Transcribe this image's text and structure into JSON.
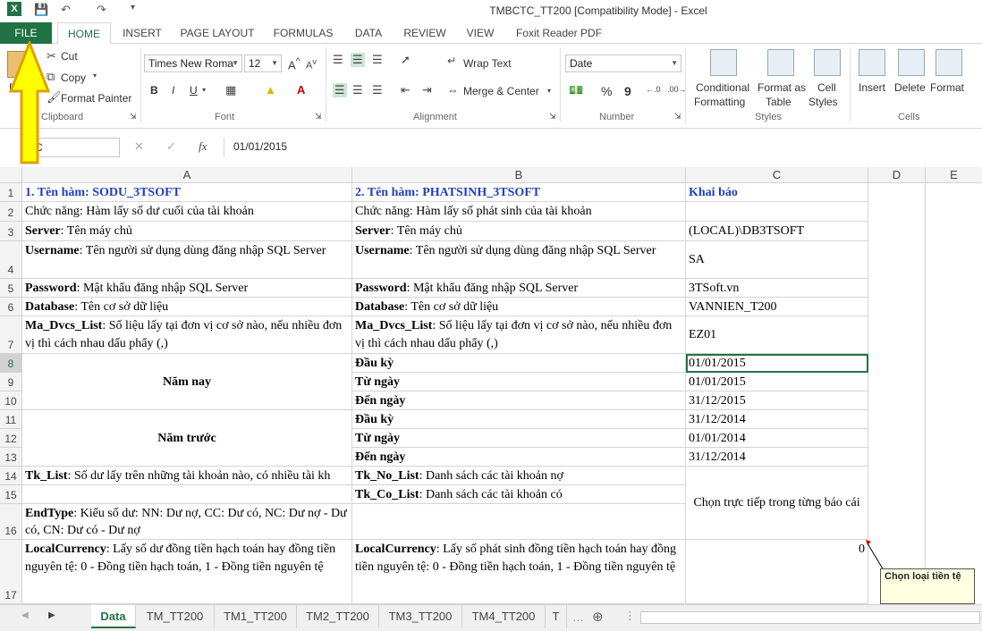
{
  "window": {
    "title": "TMBCTC_TT200  [Compatibility Mode] - Excel"
  },
  "tabs": [
    "FILE",
    "HOME",
    "INSERT",
    "PAGE LAYOUT",
    "FORMULAS",
    "DATA",
    "REVIEW",
    "VIEW",
    "Foxit Reader PDF"
  ],
  "ribbon": {
    "clipboard": {
      "paste": "P",
      "cut": "Cut",
      "copy": "Copy",
      "format_painter": "Format Painter",
      "label": "Clipboard"
    },
    "font": {
      "name": "Times New Roma",
      "size": "12",
      "label": "Font",
      "bold": "B",
      "italic": "I",
      "underline": "U"
    },
    "alignment": {
      "wrap_text": "Wrap Text",
      "merge_center": "Merge & Center",
      "label": "Alignment"
    },
    "number": {
      "format": "Date",
      "percent": "%",
      "comma": "9",
      "label": "Number"
    },
    "styles": {
      "conditional": "Conditional",
      "conditional2": "Formatting",
      "format_as": "Format as",
      "format_as2": "Table",
      "cell_styles": "Cell",
      "cell_styles2": "Styles",
      "label": "Styles"
    },
    "cells": {
      "insert": "Insert",
      "delete": "Delete",
      "format": "Format",
      "label": "Cells"
    }
  },
  "formula_bar": {
    "name_box": "C",
    "fx": "fx",
    "value": "01/01/2015"
  },
  "columns": [
    "A",
    "B",
    "C",
    "D",
    "E"
  ],
  "rows": {
    "r1": {
      "n": "1",
      "a": "1. Tên hàm: SODU_3TSOFT",
      "b": "2. Tên hàm: PHATSINH_3TSOFT",
      "c": "Khai báo"
    },
    "r2": {
      "n": "2",
      "a": "Chức năng: Hàm lấy số dư cuối của tài khoản",
      "b": "Chức năng: Hàm lấy số phát sinh của tài khoản",
      "c": ""
    },
    "r3": {
      "n": "3",
      "a_b": "Server",
      "a": ": Tên máy chủ",
      "b_b": "Server",
      "b": ": Tên máy chủ",
      "c": "(LOCAL)\\DB3TSOFT"
    },
    "r4": {
      "n": "4",
      "a_b": "Username",
      "a": ": Tên người sử dụng dùng đăng nhập SQL Server",
      "b_b": "Username",
      "b": ": Tên người sử dụng dùng đăng nhập SQL Server",
      "c": "SA"
    },
    "r5": {
      "n": "5",
      "a_b": "Password",
      "a": ": Mật khẩu đăng nhập SQL Server",
      "b_b": "Password",
      "b": ": Mật khẩu đăng nhập SQL Server",
      "c": "3TSoft.vn"
    },
    "r6": {
      "n": "6",
      "a_b": "Database",
      "a": ": Tên cơ sở dữ liệu",
      "b_b": "Database",
      "b": ": Tên cơ sở dữ liệu",
      "c": "VANNIEN_T200"
    },
    "r7": {
      "n": "7",
      "a_b": "Ma_Dvcs_List",
      "a": ": Số liệu lấy tại đơn vị cơ sở nào, nếu nhiều đơn vị thì cách nhau dấu phẩy (,)",
      "b_b": "Ma_Dvcs_List",
      "b": ": Số liệu lấy tại đơn vị cơ sở nào, nếu nhiều đơn vị thì cách nhau dấu phẩy (,)",
      "c": "EZ01"
    },
    "r8": {
      "n": "8",
      "b": "Đầu kỳ",
      "c": "01/01/2015"
    },
    "r9": {
      "n": "9",
      "b": "Từ ngày",
      "c": "01/01/2015"
    },
    "r10": {
      "n": "10",
      "b": "Đến ngày",
      "c": "31/12/2015"
    },
    "r11": {
      "n": "11",
      "b": "Đầu kỳ",
      "c": "31/12/2014"
    },
    "r12": {
      "n": "12",
      "b": "Từ ngày",
      "c": "01/01/2014"
    },
    "r13": {
      "n": "13",
      "b": "Đến ngày",
      "c": "31/12/2014"
    },
    "r14": {
      "n": "14",
      "a_b": "Tk_List",
      "a": ": Số dư lấy trên những tài khoản nào, có nhiều tài kh",
      "b_b": "Tk_No_List",
      "b": ": Danh sách các tài khoản nợ"
    },
    "r15": {
      "n": "15",
      "b_b": "Tk_Co_List",
      "b": ": Danh sách các tài khoản có"
    },
    "r16": {
      "n": "16",
      "a_b": "EndType",
      "a": ": Kiểu số dư: NN: Dư nợ, CC: Dư có, NC: Dư nợ - Dư có, CN: Dư có - Dư nợ"
    },
    "r17": {
      "n": "17",
      "a_b": "LocalCurrency",
      "a": ": Lấy số dư đồng tiền hạch toán hay đồng tiền nguyên tệ: 0 - Đồng tiền hạch toán, 1 - Đồng tiền nguyên tệ",
      "b_b": "LocalCurrency",
      "b": ": Lấy số phát sinh đồng tiền hạch toán hay đồng tiền nguyên tệ: 0 - Đồng tiền hạch toán, 1 - Đồng tiền nguyên tệ",
      "c": "0"
    },
    "merged": {
      "nam_nay": "Năm nay",
      "nam_truoc": "Năm trước",
      "chon_truc_tiep": "Chọn trực tiếp trong từng báo cái"
    }
  },
  "comment": "Chọn loại tiền tệ",
  "sheets": [
    "Data",
    "TM_TT200",
    "TM1_TT200",
    "TM2_TT200",
    "TM3_TT200",
    "TM4_TT200",
    "T"
  ],
  "colors": {
    "excel_green": "#217346",
    "arrow_fill": "#ffff00",
    "arrow_stroke": "#e0a000"
  }
}
